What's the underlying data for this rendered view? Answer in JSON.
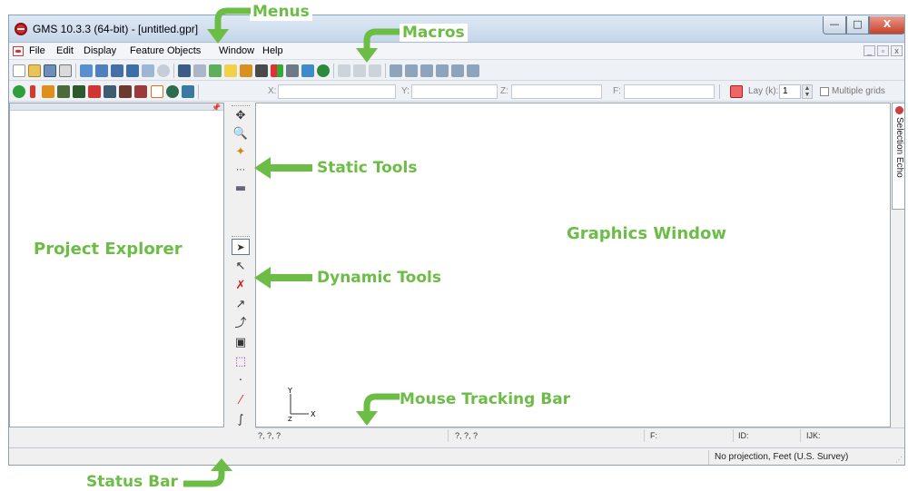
{
  "window": {
    "title": "GMS 10.3.3 (64-bit) - [untitled.gpr]",
    "minimize_glyph": "—",
    "maximize_glyph": "□",
    "close_glyph": "X"
  },
  "menubar": {
    "items": [
      "File",
      "Edit",
      "Display",
      "Feature Objects",
      "Window",
      "Help"
    ],
    "mdi_buttons": [
      "_",
      "▫",
      "x"
    ]
  },
  "toolbar2": {
    "x_label": "X:",
    "y_label": "Y:",
    "z_label": "Z:",
    "f_label": "F:",
    "lay_label": "Lay (k):",
    "lay_value": "1",
    "multiple_grids_label": "Multiple grids",
    "multiple_grids_checked": false
  },
  "selection_echo": {
    "label": "Selection Echo"
  },
  "mouse_tracking": {
    "field1": "?, ?, ?",
    "field2": "?, ?, ?",
    "f_label": "F:",
    "id_label": "ID:",
    "ijk_label": "IJK:"
  },
  "status_bar": {
    "projection": "No projection, Feet (U.S. Survey)"
  },
  "annotations": {
    "menus": "Menus",
    "macros": "Macros",
    "static_tools": "Static Tools",
    "dynamic_tools": "Dynamic Tools",
    "mouse_tracking_bar": "Mouse Tracking Bar",
    "status_bar": "Status Bar",
    "project_explorer": "Project Explorer",
    "graphics_window": "Graphics Window",
    "color": "#6cbd45"
  },
  "axis_triad": {
    "y_label": "Y",
    "z_label": "Z",
    "x_label": "X"
  },
  "icons": {
    "static_tools": [
      "pan-icon",
      "zoom-icon",
      "rotate-icon",
      "measure-icon",
      "frame-icon"
    ],
    "dynamic_tools": [
      "select-arrow-icon",
      "select-vertex-icon",
      "delete-arc-icon",
      "create-arc-icon",
      "create-arc-group-icon",
      "select-polygon-icon",
      "select-box-icon",
      "create-point-icon",
      "create-arc-red-icon",
      "create-curve-icon"
    ]
  }
}
